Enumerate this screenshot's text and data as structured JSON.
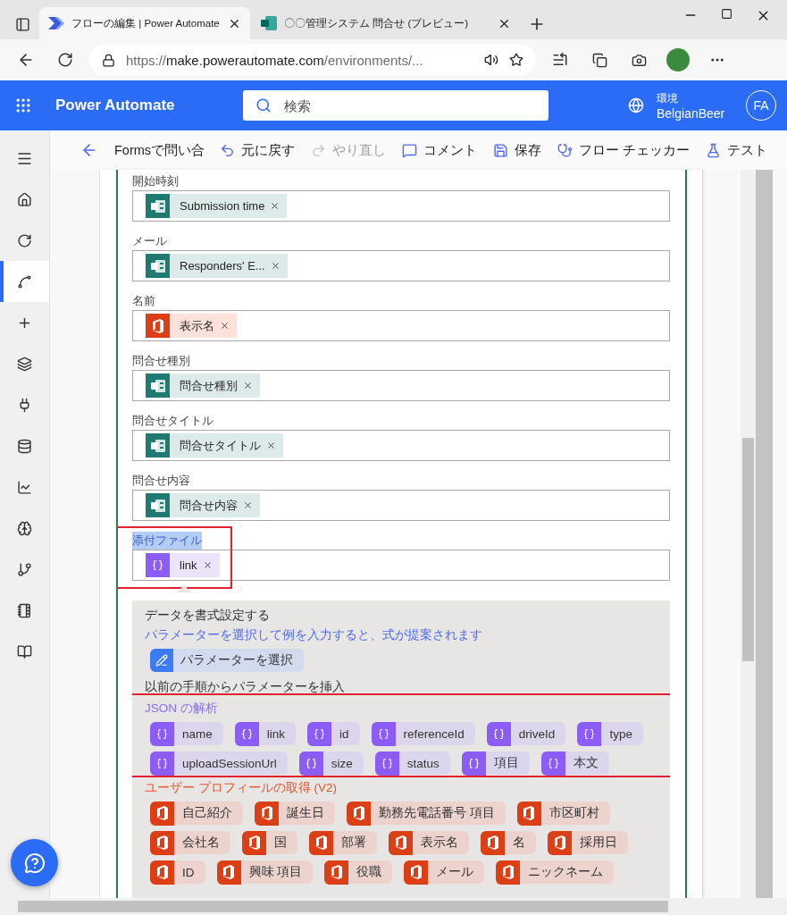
{
  "browser": {
    "tabs": [
      {
        "title": "フローの編集 | Power Automate",
        "selected": true
      },
      {
        "title": "〇〇管理システム 問合せ (プレビュー)",
        "selected": false
      }
    ],
    "url": {
      "scheme": "https://",
      "host": "make.powerautomate.com",
      "path": "/environments/..."
    }
  },
  "header": {
    "app_name": "Power Automate",
    "search": {
      "placeholder": "検索"
    },
    "environment_label": "環境",
    "environment_name": "BelgianBeer",
    "avatar": "FA"
  },
  "command_bar": {
    "title": "Formsで問い合",
    "commands": [
      {
        "label": "元に戻す",
        "kind": "undo",
        "disabled": false
      },
      {
        "label": "やり直し",
        "kind": "redo",
        "disabled": true
      },
      {
        "label": "コメント",
        "kind": "comment",
        "disabled": false
      },
      {
        "label": "保存",
        "kind": "save",
        "disabled": false
      },
      {
        "label": "フロー チェッカー",
        "kind": "checker",
        "disabled": false
      },
      {
        "label": "テスト",
        "kind": "test",
        "disabled": false
      }
    ]
  },
  "rail": {
    "items": [
      {
        "selected": false
      },
      {
        "selected": false
      },
      {
        "selected": true
      },
      {
        "selected": false
      },
      {
        "selected": false
      },
      {
        "selected": false
      },
      {
        "selected": false
      },
      {
        "selected": false
      },
      {
        "selected": false
      },
      {
        "selected": false
      },
      {
        "selected": false
      },
      {
        "selected": false
      }
    ]
  },
  "fields": [
    {
      "label": "開始時刻",
      "label_selected": false,
      "token": {
        "text": "Submission time",
        "kind": "forms"
      }
    },
    {
      "label": "メール",
      "label_selected": false,
      "token": {
        "text": "Responders' E...",
        "kind": "forms"
      }
    },
    {
      "label": "名前",
      "label_selected": false,
      "token": {
        "text": "表示名",
        "kind": "office"
      }
    },
    {
      "label": "問合せ種別",
      "label_selected": false,
      "token": {
        "text": "問合せ種別",
        "kind": "forms"
      }
    },
    {
      "label": "問合せタイトル",
      "label_selected": false,
      "token": {
        "text": "問合せタイトル",
        "kind": "forms"
      }
    },
    {
      "label": "問合せ内容",
      "label_selected": false,
      "token": {
        "text": "問合せ内容",
        "kind": "forms"
      }
    },
    {
      "label": "添付ファイル",
      "label_selected": true,
      "framed": true,
      "token": {
        "text": "link",
        "kind": "variable"
      }
    }
  ],
  "popup": {
    "heading": "データを書式設定する",
    "hint": "パラメーターを選択して例を入力すると、式が提案されます",
    "select_button": "パラメーターを選択",
    "insert_heading": "以前の手順からパラメーターを挿入",
    "groups": [
      {
        "title": "JSON の解析",
        "kind": "variable",
        "framed": true,
        "tokens": [
          "name",
          "link",
          "id",
          "referenceId",
          "driveId",
          "type",
          "uploadSessionUrl",
          "size",
          "status",
          "項目",
          "本文"
        ]
      },
      {
        "title": "ユーザー プロフィールの取得 (V2)",
        "kind": "office",
        "tokens": [
          "自己紹介",
          "誕生日",
          "勤務先電話番号 項目",
          "市区町村",
          "会社名",
          "国",
          "部署",
          "表示名",
          "名",
          "採用日",
          "ID",
          "興味 項目",
          "役職",
          "メール",
          "ニックネーム"
        ]
      }
    ]
  }
}
